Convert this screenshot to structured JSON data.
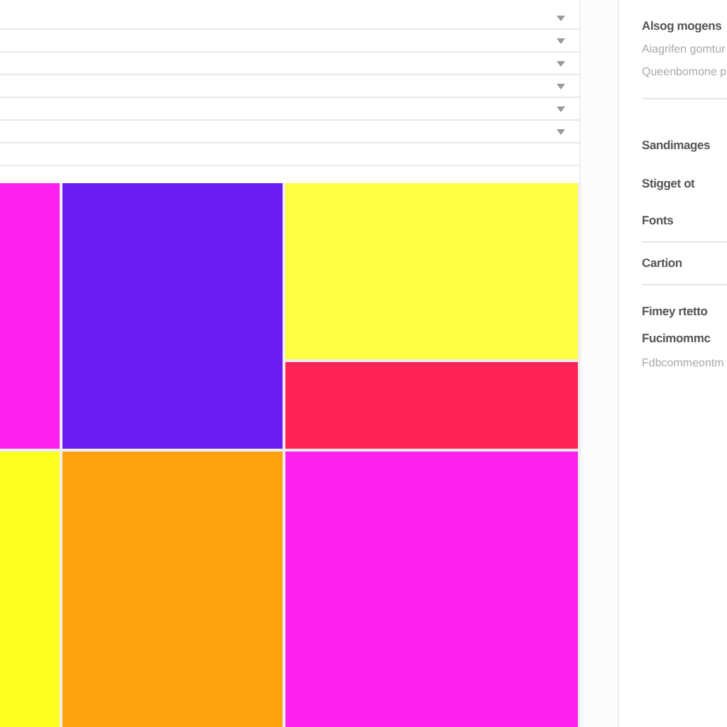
{
  "dropdowns": [
    {
      "kind": "select"
    },
    {
      "kind": "select"
    },
    {
      "kind": "select"
    },
    {
      "kind": "select"
    },
    {
      "kind": "select"
    },
    {
      "kind": "select"
    },
    {
      "kind": "blank"
    }
  ],
  "tiles": [
    {
      "color": "#ff22ee"
    },
    {
      "color": "#6a1df0"
    },
    {
      "color": "#ffff44"
    },
    {
      "color": "#ff2255"
    },
    {
      "color": "#ffff22"
    },
    {
      "color": "#ffa20f"
    },
    {
      "color": "#ff22ee"
    }
  ],
  "panel": {
    "sections": [
      {
        "items": [
          {
            "label": "Alsog mogens",
            "kind": "title"
          },
          {
            "label": "Aiagrifen gomtur",
            "kind": "muted"
          },
          {
            "label": "Queenbomone p",
            "kind": "muted"
          }
        ]
      },
      {
        "items": [
          {
            "label": "Sandimages",
            "kind": "title"
          },
          {
            "label": "Stigget ot",
            "kind": "title"
          },
          {
            "label": "Fonts",
            "kind": "title"
          }
        ]
      },
      {
        "items": [
          {
            "label": "Cartion",
            "kind": "title"
          }
        ]
      },
      {
        "items": [
          {
            "label": "Fimey rtetto",
            "kind": "title"
          },
          {
            "label": "Fucimommc",
            "kind": "title"
          },
          {
            "label": "Fdbcommeontm",
            "kind": "muted"
          }
        ]
      }
    ]
  }
}
